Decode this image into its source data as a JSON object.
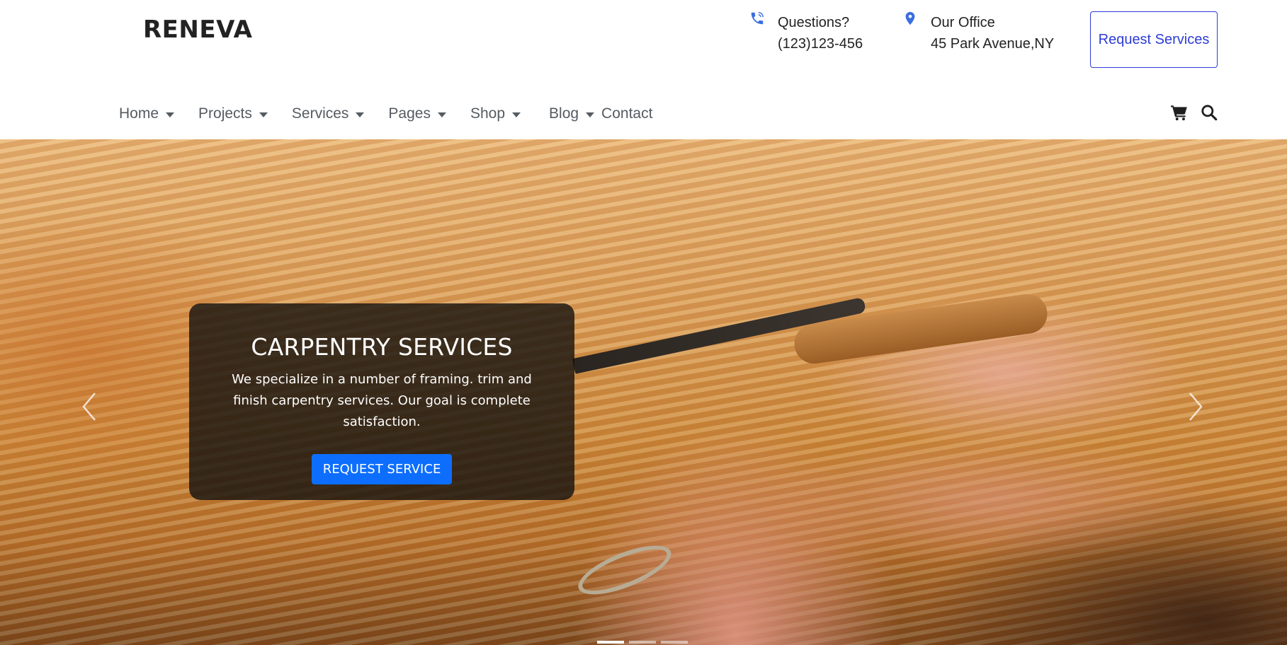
{
  "brand": {
    "logo_text": "RENEVA"
  },
  "header": {
    "phone": {
      "icon": "phone-icon",
      "title": "Questions?",
      "value": "(123)123-456"
    },
    "office": {
      "icon": "map-pin-icon",
      "title": "Our Office",
      "value": "45 Park Avenue,NY"
    },
    "request_button": "Request Services",
    "accent_color": "#2d3cd6"
  },
  "nav": {
    "items": [
      {
        "label": "Home",
        "dropdown": true
      },
      {
        "label": "Projects",
        "dropdown": true
      },
      {
        "label": "Services",
        "dropdown": true
      },
      {
        "label": "Pages",
        "dropdown": true
      },
      {
        "label": "Shop",
        "dropdown": true
      },
      {
        "label": "Blog",
        "dropdown": true
      },
      {
        "label": "Contact",
        "dropdown": false
      }
    ],
    "utility_icons": [
      "cart-icon",
      "search-icon"
    ]
  },
  "hero": {
    "slide": {
      "title": "CARPENTRY SERVICES",
      "text": "We specialize in a number of framing. trim and finish carpentry services. Our goal is complete satisfaction.",
      "button": "REQUEST SERVICE",
      "button_color": "#0d6efd"
    },
    "controls": {
      "prev_icon": "chevron-left-icon",
      "next_icon": "chevron-right-icon"
    },
    "indicators": {
      "count": 3,
      "active_index": 0
    }
  }
}
